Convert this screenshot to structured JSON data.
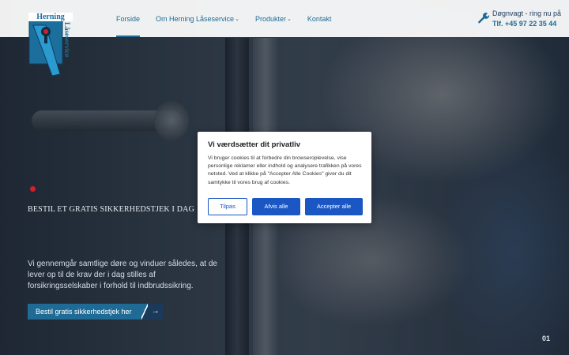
{
  "logo": {
    "top_text": "Herning",
    "side_text": "Låseservice"
  },
  "nav": {
    "items": [
      {
        "label": "Forside",
        "has_dropdown": false,
        "active": true
      },
      {
        "label": "Om Herning Låseservice",
        "has_dropdown": true,
        "active": false
      },
      {
        "label": "Produkter",
        "has_dropdown": true,
        "active": false
      },
      {
        "label": "Kontakt",
        "has_dropdown": false,
        "active": false
      }
    ]
  },
  "contact": {
    "label": "Døgnvagt - ring nu på",
    "phone": "Tlf. +45 97 22 35 44",
    "icon": "wrench-icon"
  },
  "hero": {
    "title": "BESTIL ET GRATIS SIKKERHEDSTJEK I DAG",
    "description": "Vi gennemgår samtlige døre og vinduer således, at de lever op til de krav der i dag stilles af forsikringsselskaber i forhold til indbrudssikring.",
    "cta_label": "Bestil gratis sikkerhedstjek her",
    "cta_arrow": "→",
    "slide_number": "01"
  },
  "cookie": {
    "title": "Vi værdsætter dit privatliv",
    "text": "Vi bruger cookies til at forbedre din browseroplevelse, vise personlige reklamer eller indhold og analysere trafikken på vores netsted. Ved at klikke på \"Accepter Alle Cookies\" giver du dit samtykke til vores brug af cookies.",
    "buttons": {
      "customize": "Tilpas",
      "reject": "Afvis alle",
      "accept": "Accepter alle"
    }
  },
  "colors": {
    "brand": "#1f6b96",
    "button": "#1a56c4",
    "accent_red": "#d0202a"
  }
}
